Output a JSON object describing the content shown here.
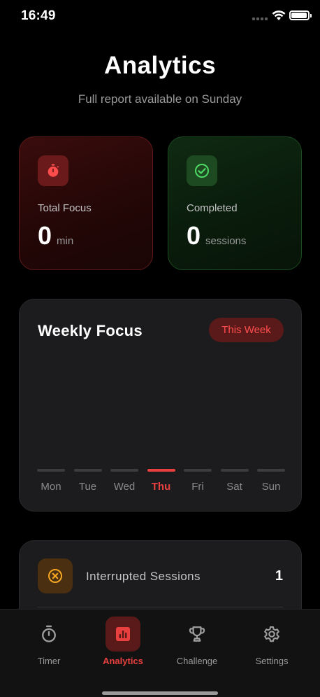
{
  "status_bar": {
    "time": "16:49"
  },
  "header": {
    "title": "Analytics",
    "subtitle": "Full report available on Sunday"
  },
  "stats": {
    "focus": {
      "label": "Total Focus",
      "value": "0",
      "unit": "min",
      "icon": "stopwatch-icon"
    },
    "completed": {
      "label": "Completed",
      "value": "0",
      "unit": "sessions",
      "icon": "check-circle-icon"
    }
  },
  "weekly": {
    "title": "Weekly Focus",
    "range_label": "This Week",
    "days": [
      "Mon",
      "Tue",
      "Wed",
      "Thu",
      "Fri",
      "Sat",
      "Sun"
    ],
    "active_day": "Thu"
  },
  "interrupted": {
    "label": "Interrupted Sessions",
    "count": "1",
    "icon": "x-circle-icon"
  },
  "tabs": [
    {
      "label": "Timer",
      "icon": "stopwatch-icon"
    },
    {
      "label": "Analytics",
      "icon": "bar-chart-icon"
    },
    {
      "label": "Challenge",
      "icon": "trophy-icon"
    },
    {
      "label": "Settings",
      "icon": "gear-icon"
    }
  ],
  "active_tab": "Analytics",
  "colors": {
    "accent": "#e8403e",
    "success": "#2ecc40",
    "warning": "#f5a623",
    "background": "#000000"
  }
}
